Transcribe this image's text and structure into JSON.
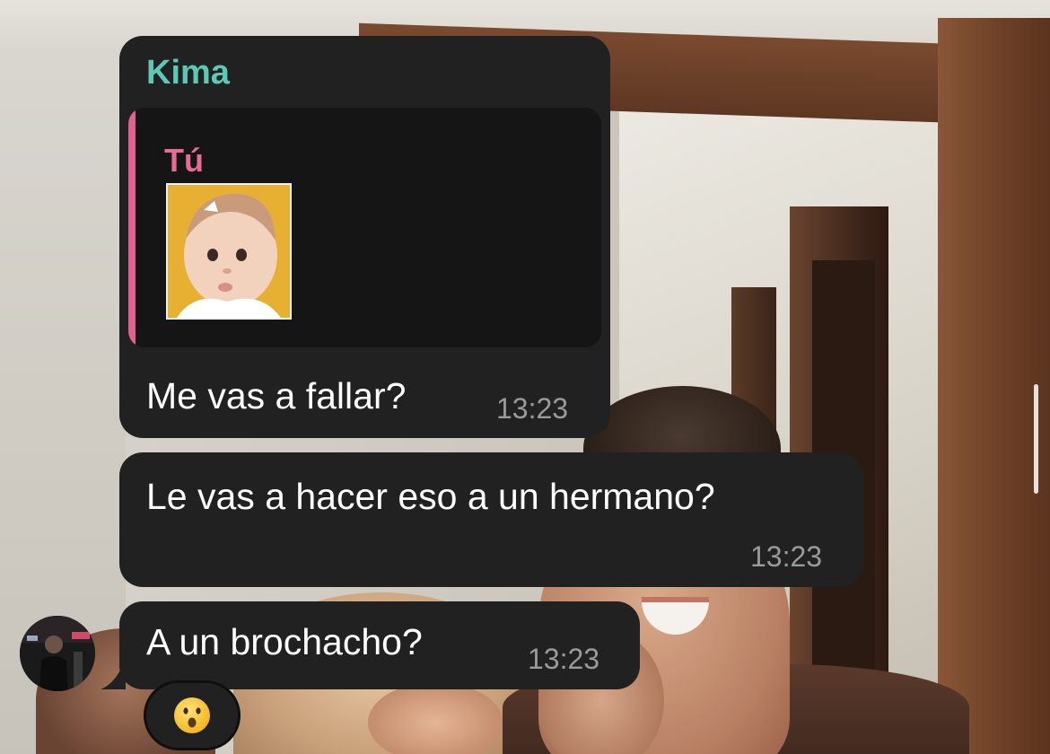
{
  "chat": {
    "messages": [
      {
        "sender": "Kima",
        "reply": {
          "author": "Tú",
          "thumbnail": "baby-photo"
        },
        "text": "Me vas a fallar?",
        "time": "13:23"
      },
      {
        "text": "Le vas a hacer eso a un hermano?",
        "time": "13:23"
      },
      {
        "text": "A un brochacho?",
        "time": "13:23",
        "reaction": "😮"
      }
    ]
  },
  "colors": {
    "bubble": "#212121",
    "sender_name": "#5cc8b5",
    "reply_accent": "#e0618e",
    "timestamp": "#9a9a9a"
  },
  "icons": {
    "avatar": "contact-avatar",
    "reaction": "surprised-face-emoji"
  }
}
